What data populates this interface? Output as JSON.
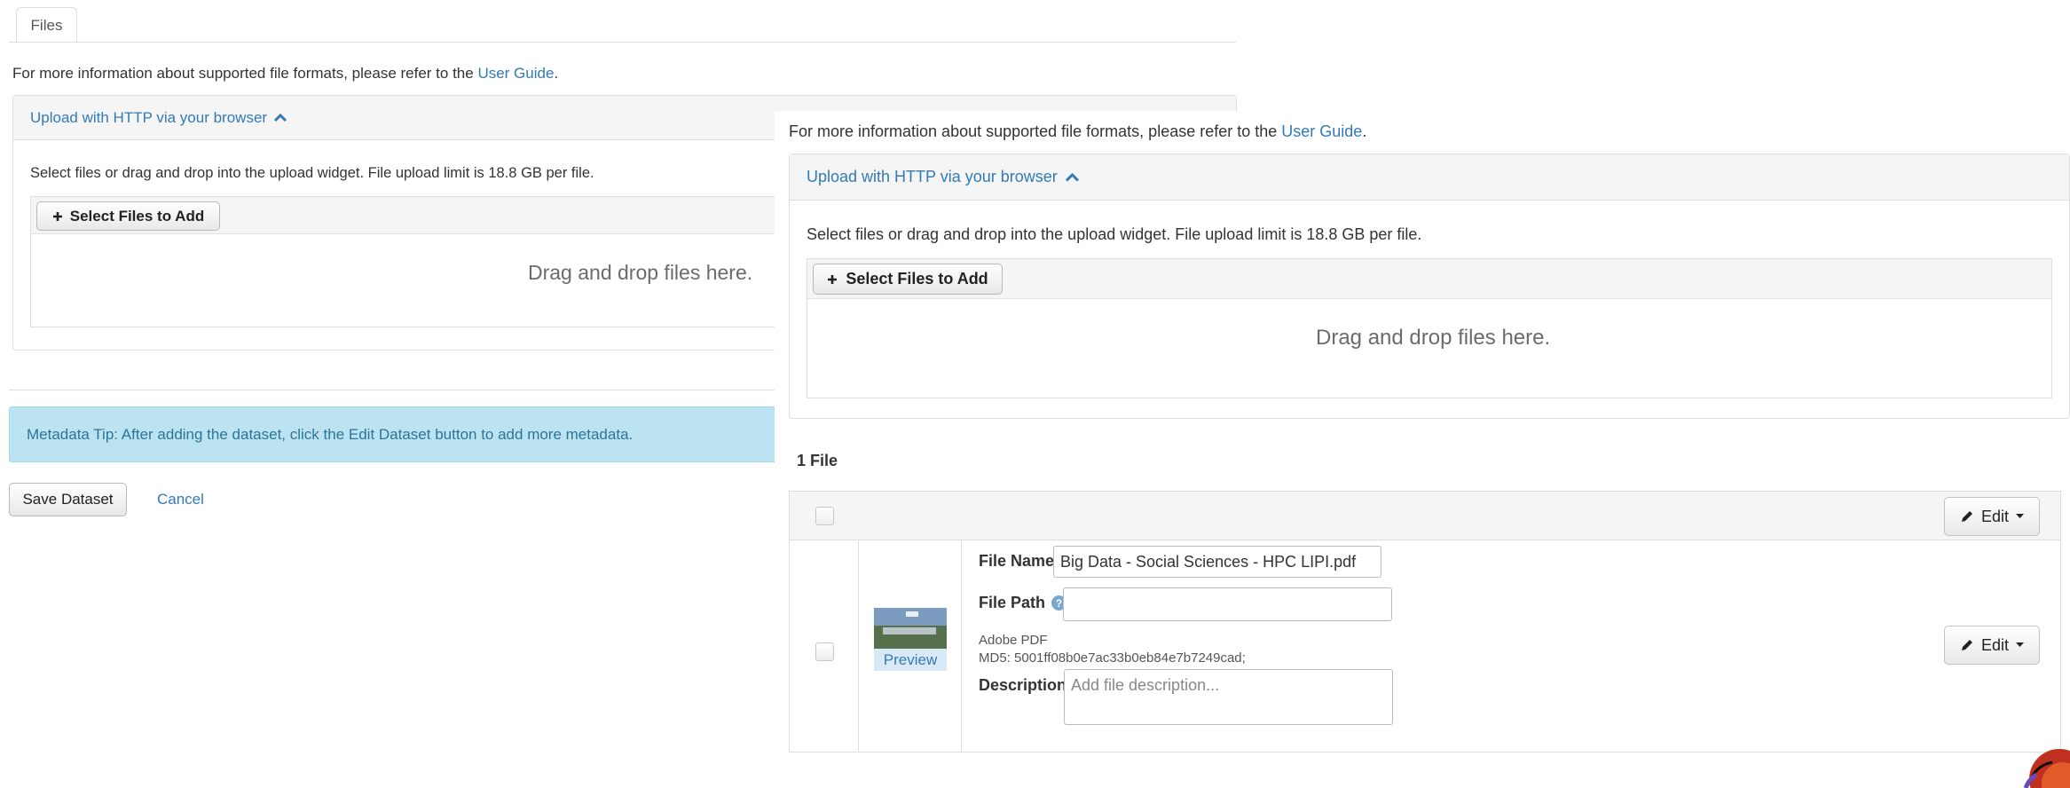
{
  "background_screen": {
    "tab_label": "Files",
    "info_prefix": "For more information about supported file formats, please refer to the ",
    "info_link": "User Guide",
    "info_suffix": ".",
    "upload_header": "Upload with HTTP via your browser",
    "upload_instructions": "Select files or drag and drop into the upload widget. File upload limit is 18.8 GB per file.",
    "select_files_label": "Select Files to Add",
    "drag_drop_text": "Drag and drop files here.",
    "metadata_tip": "Metadata Tip: After adding the dataset, click the Edit Dataset button to add more metadata.",
    "save_label": "Save Dataset",
    "cancel_label": "Cancel"
  },
  "foreground_screen": {
    "info_prefix": "For more information about supported file formats, please refer to the ",
    "info_link": "User Guide",
    "info_suffix": ".",
    "upload_header": "Upload with HTTP via your browser",
    "upload_instructions": "Select files or drag and drop into the upload widget. File upload limit is 18.8 GB per file.",
    "select_files_label": "Select Files to Add",
    "drag_drop_text": "Drag and drop files here.",
    "file_count": "1 File",
    "edit_label": "Edit",
    "file": {
      "preview_label": "Preview",
      "file_name_label": "File Name",
      "file_name_value": "Big Data - Social Sciences - HPC LIPI.pdf",
      "file_path_label": "File Path",
      "file_path_value": "",
      "file_type": "Adobe PDF",
      "md5": "MD5: 5001ff08b0e7ac33b0eb84e7b7249cad;",
      "description_label": "Description",
      "description_placeholder": "Add file description..."
    }
  },
  "colors": {
    "link": "#337ab7",
    "tip_background": "#bce3f1",
    "tip_text": "#2e7497",
    "panel_header": "#f5f5f5"
  },
  "icons": [
    "plus-icon",
    "chevron-up-icon",
    "pencil-icon",
    "caret-down-icon",
    "question-icon",
    "mascot-image"
  ]
}
